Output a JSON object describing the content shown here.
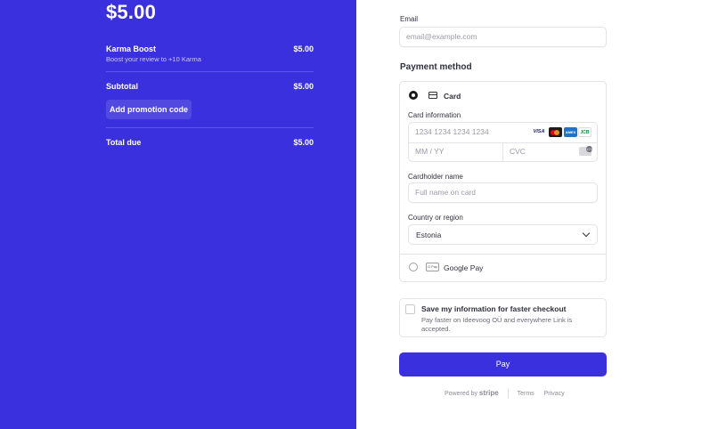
{
  "summary": {
    "amount": "$5.00",
    "line_item": {
      "name": "Karma Boost",
      "description": "Boost your review to +10 Karma",
      "price": "$5.00"
    },
    "subtotal_label": "Subtotal",
    "subtotal_value": "$5.00",
    "promo_label": "Add promotion code",
    "total_label": "Total due",
    "total_value": "$5.00",
    "accent_color": "#3b30dd"
  },
  "form": {
    "email_label": "Email",
    "email_placeholder": "email@example.com",
    "payment_method_title": "Payment method",
    "card_option_label": "Card",
    "card_info_label": "Card information",
    "card_number_placeholder": "1234 1234 1234 1234",
    "expiry_placeholder": "MM / YY",
    "cvc_placeholder": "CVC",
    "card_brands": [
      "VISA",
      "mastercard",
      "AMEX",
      "JCB"
    ],
    "cardholder_label": "Cardholder name",
    "cardholder_placeholder": "Full name on card",
    "country_label": "Country or region",
    "country_value": "Estonia",
    "gpay_icon_text": "G Pay",
    "gpay_label": "Google Pay",
    "save_title": "Save my information for faster checkout",
    "save_description": "Pay faster on Ideevoog OÜ and everywhere Link is accepted.",
    "pay_label": "Pay"
  },
  "footer": {
    "powered_by": "Powered by",
    "brand": "stripe",
    "terms": "Terms",
    "privacy": "Privacy"
  }
}
